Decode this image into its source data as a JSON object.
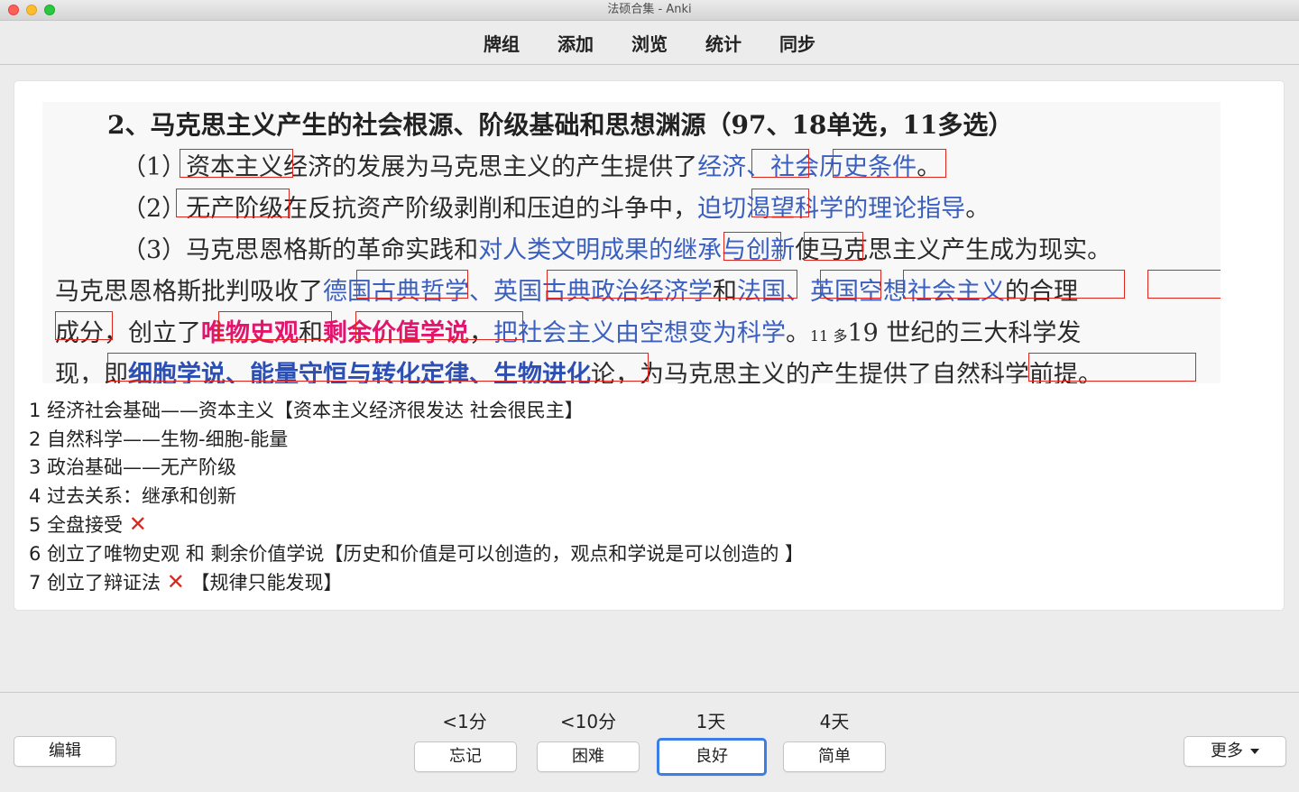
{
  "window": {
    "title": "法硕合集 - Anki"
  },
  "toolbar": {
    "items": [
      "牌组",
      "添加",
      "浏览",
      "统计",
      "同步"
    ]
  },
  "card": {
    "image": {
      "title": "2、马克思主义产生的社会根源、阶级基础和思想渊源（97、18单选，11多选）",
      "line1": {
        "a": "（1）资本主义经济的发展为马克思主义的产生提供了",
        "b": "经济、社会历史条件",
        "c": "。"
      },
      "line2": {
        "a": "（2）无产阶级在反抗资产阶级剥削和压迫的斗争中，",
        "b": "迫切渴望科学的理论指导",
        "c": "。"
      },
      "line3": {
        "a": "（3）马克思恩格斯的革命实践和",
        "b": "对人类文明成果的继承与创新",
        "c": "使马克思主义产生成为现实。"
      },
      "line4": {
        "a": "马克思恩格斯批判吸收了",
        "b": "德国古典哲学、英国古典政治经济学",
        "c": "和",
        "d": "法国、英国空想社会主义",
        "e": "的合理"
      },
      "line5": {
        "a": "成分，创立了",
        "b": "唯物史观",
        "c": "和",
        "d": "剩余价值学说",
        "e": "，",
        "f": "把社会主义由空想变为科学",
        "g": "。",
        "h": "11 多",
        "i": "19 世纪的三大科学发"
      },
      "line6": {
        "a": "现，即",
        "b": "细胞学说、能量守恒与转化定律、生物进化",
        "c": "论，为马克思主义的产生提供了自然科学前提。"
      }
    },
    "notes": [
      {
        "text": "1 经济社会基础——资本主义【资本主义经济很发达 社会很民主】",
        "mark": ""
      },
      {
        "text": "2 自然科学——生物-细胞-能量",
        "mark": ""
      },
      {
        "text": "3 政治基础——无产阶级",
        "mark": ""
      },
      {
        "text": "4 过去关系：继承和创新",
        "mark": ""
      },
      {
        "text": "5 全盘接受 ",
        "mark": "✕"
      },
      {
        "text": "6 创立了唯物史观 和 剩余价值学说【历史和价值是可以创造的，观点和学说是可以创造的 】",
        "mark": ""
      },
      {
        "text": "7 创立了辩证法 ",
        "mark": "✕",
        "after": " 【规律只能发现】"
      }
    ]
  },
  "bottom": {
    "edit_label": "编辑",
    "more_label": "更多",
    "answers": [
      {
        "due": "<1分",
        "label": "忘记"
      },
      {
        "due": "<10分",
        "label": "困难"
      },
      {
        "due": "1天",
        "label": "良好"
      },
      {
        "due": "4天",
        "label": "简单"
      }
    ]
  }
}
